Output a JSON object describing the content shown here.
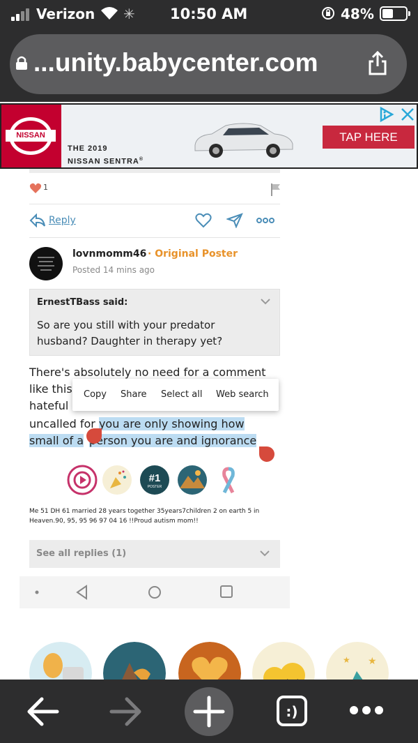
{
  "status_bar": {
    "carrier": "Verizon",
    "time": "10:50 AM",
    "battery_percent": "48%",
    "battery_level": 0.48
  },
  "browser": {
    "url": "...unity.babycenter.com"
  },
  "ad": {
    "brand": "NISSAN",
    "headline_line1": "THE 2019",
    "headline_line2": "NISSAN SENTRA",
    "cta": "TAP HERE",
    "brand_color": "#c3002f"
  },
  "previous_post": {
    "like_count": "1",
    "reply_label": "Reply"
  },
  "post": {
    "username": "lovnmomm46",
    "role": "· Original Poster",
    "posted": "Posted 14 mins ago",
    "quote": {
      "author": "ErnestTBass said:",
      "text": "So are you still with your predator husband? Daughter in therapy yet?"
    },
    "body_lines": [
      "There's absolutely no need for a comment",
      "like this",
      "hateful",
      "uncalled for",
      "you are only showing how",
      "small of a",
      "person you are and ignorance"
    ],
    "signature": "Me 51 DH 61 married 28 years together 35years7children 2 on earth 5 in Heaven.90, 95, 95 96 97 04 16 !!Proud autism mom!!",
    "see_all_replies": "See all replies (1)",
    "badges": [
      "video-badge",
      "party-badge",
      "number-one-poster-badge",
      "mountain-badge",
      "awareness-ribbon-badge"
    ],
    "number_one_badge_text": "#1",
    "number_one_badge_sub": "POSTER"
  },
  "context_menu": {
    "items": [
      "Copy",
      "Share",
      "Select all",
      "Web search"
    ]
  },
  "accent_colors": {
    "link": "#4a8db7",
    "original_poster": "#e8922a",
    "selection": "#bcdcf2",
    "handle": "#d64a3c"
  }
}
